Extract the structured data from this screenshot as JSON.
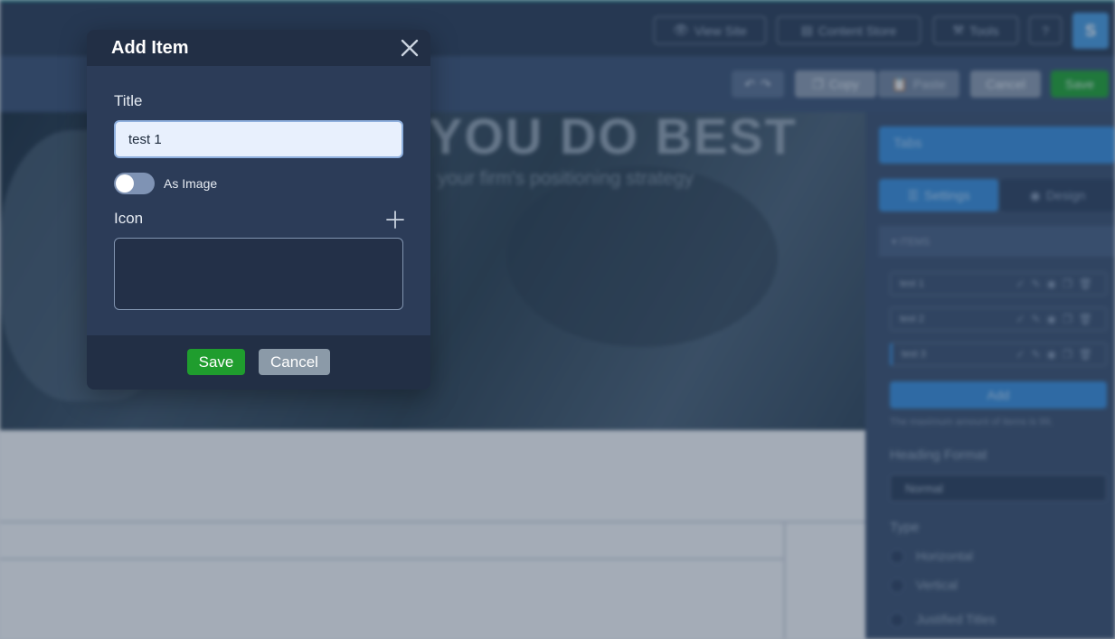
{
  "topbar": {
    "view_site": "View Site",
    "content_store": "Content Store",
    "tools": "Tools",
    "help": "?",
    "avatar_initial": "S",
    "view_site_icon": "eye-icon",
    "content_store_icon": "store-icon",
    "tools_icon": "wrench-icon"
  },
  "toolbar": {
    "copy": "Copy",
    "paste": "Paste",
    "cancel": "Cancel",
    "save": "Save",
    "undo_icon": "undo-icon",
    "redo_icon": "redo-icon"
  },
  "hero": {
    "title": "YOU DO BEST",
    "subtitle": "your firm's positioning strategy"
  },
  "right_panel": {
    "header": "Tabs",
    "settings_tab": "Settings",
    "design_tab": "Design",
    "items_section": "ITEMS",
    "items": [
      {
        "label": "test 1"
      },
      {
        "label": "test 2"
      },
      {
        "label": "test 3"
      }
    ],
    "add_button": "Add",
    "note": "The maximum amount of items is 99.",
    "heading_format_label": "Heading Format",
    "heading_format_value": "Normal",
    "type_label": "Type",
    "type_options": [
      "Horizontal",
      "Vertical",
      "Justified Titles"
    ],
    "type_selected": "Horizontal"
  },
  "modal": {
    "title": "Add Item",
    "title_label": "Title",
    "title_value": "test 1",
    "as_image_label": "As Image",
    "as_image_on": false,
    "icon_label": "Icon",
    "save": "Save",
    "cancel": "Cancel"
  },
  "colors": {
    "modal_header": "#222f45",
    "modal_body": "#2c3c58",
    "save_green": "#1f9d2e",
    "cancel_gray": "#8b9aa8",
    "accent_blue": "#3a8fdc"
  }
}
